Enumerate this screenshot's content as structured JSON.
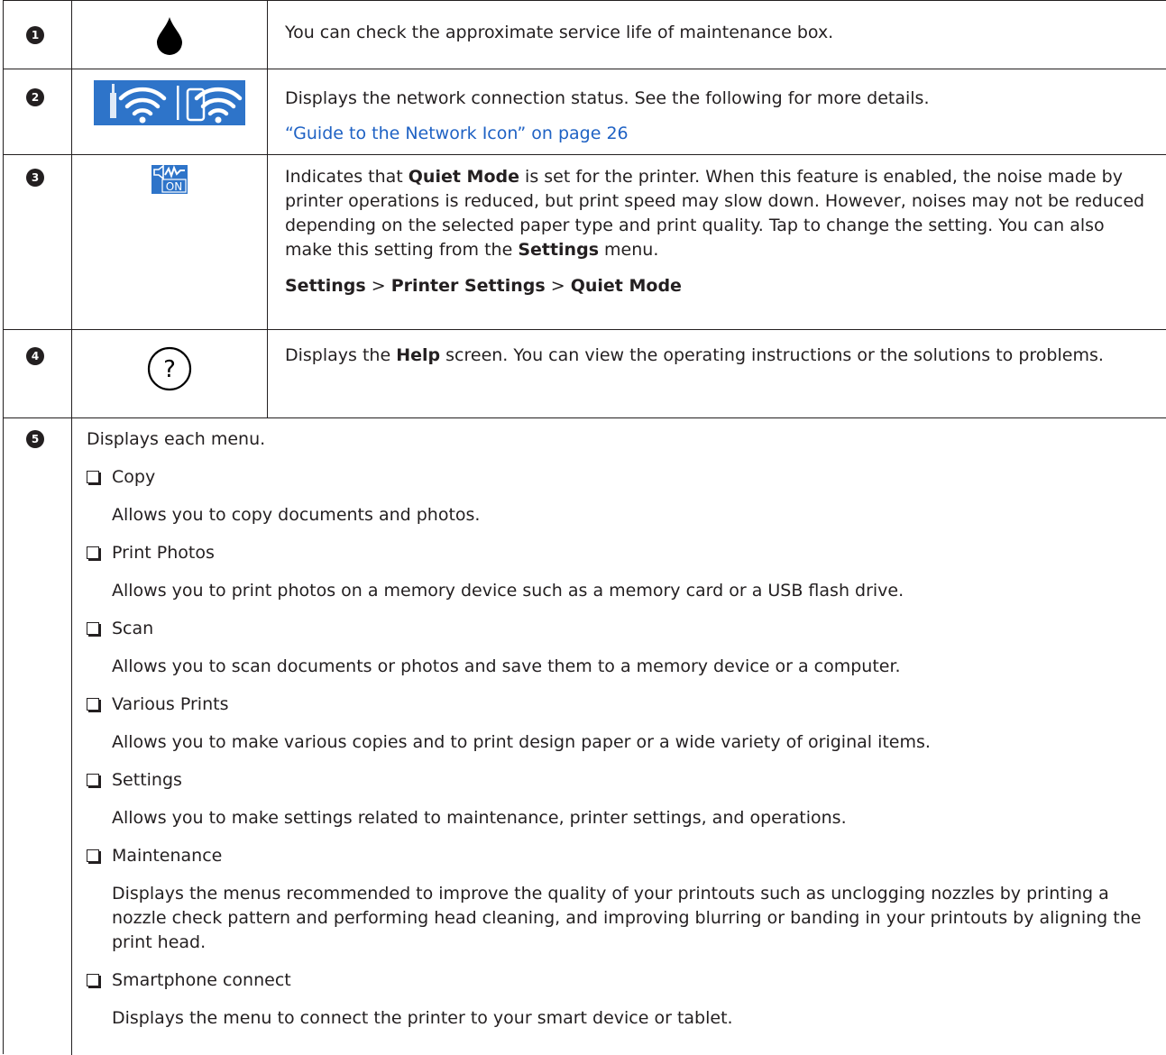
{
  "colors": {
    "text": "#231f20",
    "link": "#1f62c4",
    "icon_bg": "#2e74c9",
    "icon_fg": "#ffffff"
  },
  "rows": [
    {
      "num": "1",
      "icon": "ink-drop-icon",
      "desc": "You can check the approximate service life of maintenance box."
    },
    {
      "num": "2",
      "icon": "network-status-icon",
      "desc": "Displays the network connection status. See the following for more details.",
      "link": "“Guide to the Network Icon” on page 26"
    },
    {
      "num": "3",
      "icon": "quiet-mode-icon",
      "icon_text": "ON",
      "desc": {
        "p1_a": "Indicates that ",
        "p1_b": "Quiet Mode",
        "p1_c": " is set for the printer. When this feature is enabled, the noise made by printer operations is reduced, but print speed may slow down. However, noises may not be reduced depending on the selected paper type and print quality. Tap to change the setting. You can also make this setting from the ",
        "p1_d": "Settings",
        "p1_e": " menu.",
        "path_1": "Settings",
        "sep": ">",
        "path_2": "Printer Settings",
        "path_3": "Quiet Mode"
      }
    },
    {
      "num": "4",
      "icon": "help-icon",
      "icon_text": "?",
      "desc": {
        "a": "Displays the ",
        "b": "Help",
        "c": " screen. You can view the operating instructions or the solutions to problems."
      }
    },
    {
      "num": "5",
      "intro": "Displays each menu.",
      "items": [
        {
          "label": "Copy",
          "desc": "Allows you to copy documents and photos."
        },
        {
          "label": "Print Photos",
          "desc": "Allows you to print photos on a memory device such as a memory card or a USB flash drive."
        },
        {
          "label": "Scan",
          "desc": "Allows you to scan documents or photos and save them to a memory device or a computer."
        },
        {
          "label": "Various Prints",
          "desc": "Allows you to make various copies and to print design paper or a wide variety of original items."
        },
        {
          "label": "Settings",
          "desc": "Allows you to make settings related to maintenance, printer settings, and operations."
        },
        {
          "label": "Maintenance",
          "desc": "Displays the menus recommended to improve the quality of your printouts such as unclogging nozzles by printing a nozzle check pattern and performing head cleaning, and improving blurring or banding in your printouts by aligning the print head."
        },
        {
          "label": "Smartphone connect",
          "desc": "Displays the menu to connect the printer to your smart device or tablet."
        }
      ]
    }
  ]
}
